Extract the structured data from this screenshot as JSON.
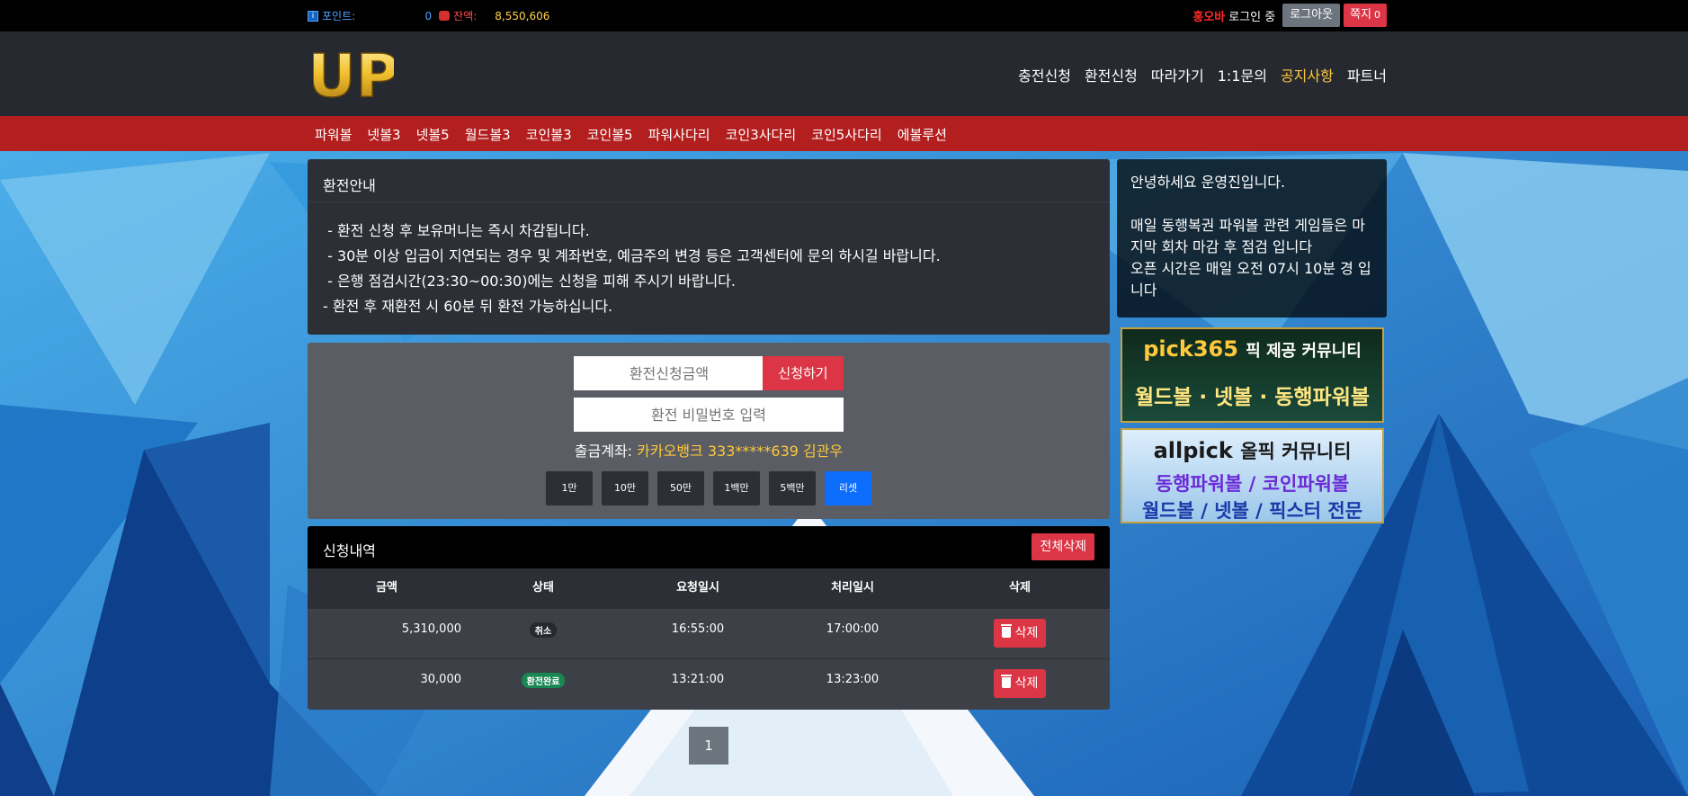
{
  "topbar": {
    "points_label": "포인트:",
    "points_value": "0",
    "balance_label": "잔액:",
    "balance_value": "8,550,606",
    "username": "홍오바",
    "logged_in_text": "로그인 중",
    "logout_label": "로그아웃",
    "message_label": "쪽지",
    "message_count": "0"
  },
  "header": {
    "logo_text": "UP",
    "nav": [
      "충전신청",
      "환전신청",
      "따라가기",
      "1:1문의",
      "공지사항",
      "파트너"
    ],
    "nav_active": "공지사항"
  },
  "gamebar": {
    "games": [
      "파워볼",
      "넷볼3",
      "넷볼5",
      "월드볼3",
      "코인볼3",
      "코인볼5",
      "파워사다리",
      "코인3사다리",
      "코인5사다리",
      "에볼루션"
    ]
  },
  "info_panel": {
    "title": "환전안내",
    "lines": [
      " - 환전 신청 후 보유머니는 즉시 차감됩니다.",
      " - 30분 이상 입금이 지연되는 경우 및 계좌번호, 예금주의 변경 등은 고객센터에 문의 하시길 바랍니다.",
      " - 은행 점검시간(23:30~00:30)에는 신청을 피해 주시기 바랍니다.",
      "- 환전 후 재환전 시 60분 뒤 환전 가능하십니다."
    ]
  },
  "form": {
    "amount_placeholder": "환전신청금액",
    "apply_label": "신청하기",
    "password_placeholder": "환전 비밀번호 입력",
    "account_label": "출금계좌:",
    "account_value": "카카오뱅크 333*****639 김관우",
    "quick_buttons": [
      "1만",
      "10만",
      "50만",
      "1백만",
      "5백만"
    ],
    "reset_label": "리셋"
  },
  "history": {
    "title": "신청내역",
    "delete_all_label": "전체삭제",
    "columns": [
      "금액",
      "상태",
      "요청일시",
      "처리일시",
      "삭제"
    ],
    "rows": [
      {
        "amount": "5,310,000",
        "status": "취소",
        "requested": "16:55:00",
        "processed": "17:00:00",
        "delete_label": "삭제"
      },
      {
        "amount": "30,000",
        "status": "환전완료",
        "requested": "13:21:00",
        "processed": "13:23:00",
        "delete_label": "삭제"
      }
    ]
  },
  "pagination": {
    "current": "1"
  },
  "side_notice": {
    "lines": [
      "안녕하세요 운영진입니다.",
      "",
      "매일 동행복권 파워볼 관련 게임들은 마지막 회차 마감 후 점검 입니다",
      "오픈 시간은 매일 오전 07시 10분 경 입니다"
    ]
  },
  "banners": {
    "pick365": {
      "name": "pick365",
      "tag": "픽 제공 커뮤니티",
      "sub": "월드볼 · 넷볼 · 동행파워볼"
    },
    "allpick": {
      "name": "allpick",
      "tag": "올픽 커뮤니티",
      "sub1": "동행파워볼 / 코인파워볼",
      "sub2": "월드볼 / 넷볼 / 픽스터 전문"
    }
  },
  "colors": {
    "accent_red": "#dc3545",
    "nav_bar": "#b31f1f",
    "active_nav": "#ffc83d",
    "reset_blue": "#0d6efd"
  }
}
